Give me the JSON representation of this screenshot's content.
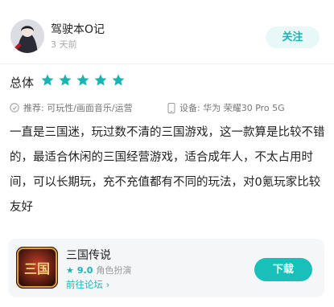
{
  "user": {
    "name": "驾驶本O记",
    "time": "3 天前",
    "follow_label": "关注"
  },
  "rating": {
    "label": "总体",
    "stars": 5,
    "max_stars": 5,
    "star_color": "#1ab4b4"
  },
  "meta": {
    "recommend": "推荐: 可玩性/画面音乐/运营",
    "device": "设备: 华为 荣耀30 Pro 5G"
  },
  "review": {
    "text": "一直是三国迷，玩过数不清的三国游戏，这一款算是比较不错的，最适合休闲的三国经营游戏，适合成年人，不太占用时间，可以长期玩，充不充值都有不同的玩法，对0氪玩家比较友好"
  },
  "game": {
    "name": "三国传说",
    "score": "9.0",
    "genre": "角色扮演",
    "forum_link": "前往论坛",
    "download_label": "下载",
    "icon_text": "三国"
  }
}
